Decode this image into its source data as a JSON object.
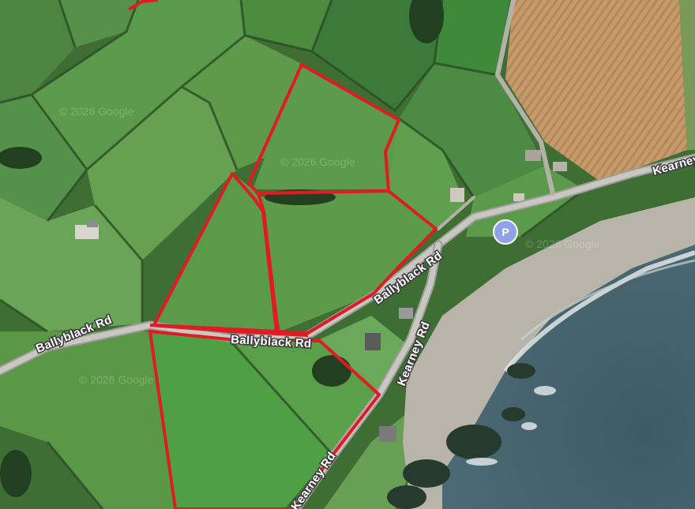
{
  "map": {
    "roads": {
      "ballyblack_west": "Ballyblack Rd",
      "ballyblack_center": "Ballyblack Rd",
      "ballyblack_east": "Ballyblack Rd",
      "kearney_main": "Kearney Rd",
      "kearney_south": "Kearney Rd",
      "kearney_top": "Kearney Rd"
    },
    "watermarks": [
      "© 2026 Google",
      "© 2026 Google",
      "© 2026 Google",
      "© 2026 Google"
    ],
    "parking": {
      "label": "P",
      "color": "#8ea2e8"
    },
    "boundary_color": "#e01b24"
  }
}
